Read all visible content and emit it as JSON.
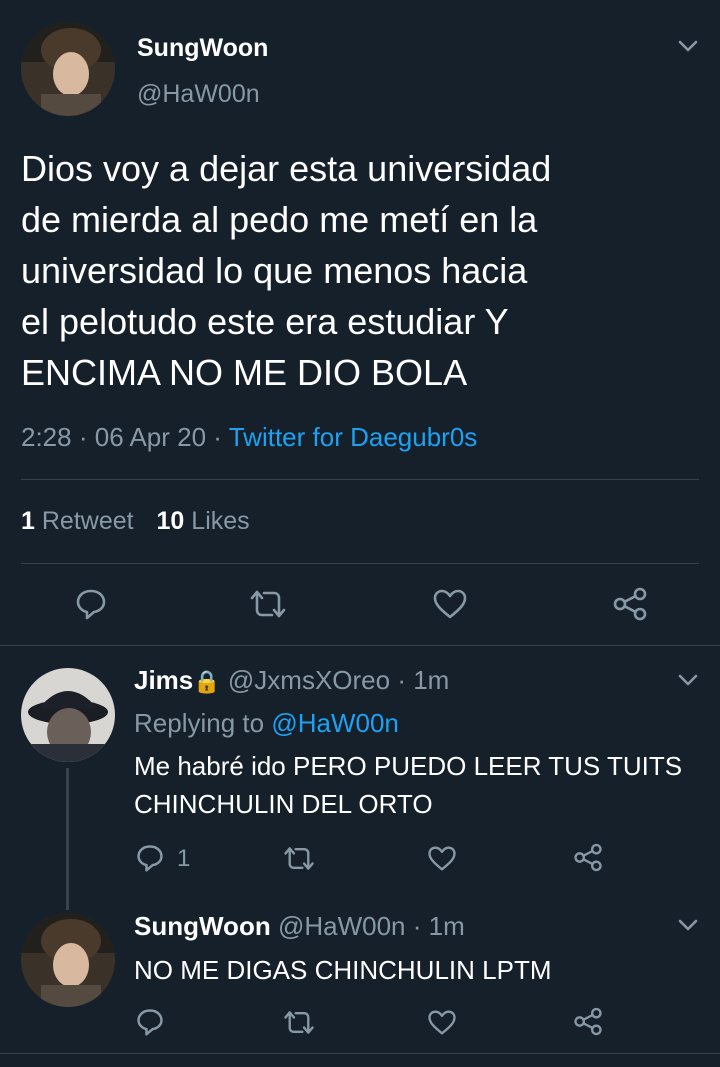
{
  "main_tweet": {
    "display_name": "SungWoon",
    "handle": "@HaW00n",
    "text_lines": [
      "Dios voy a dejar esta universidad",
      "de mierda al pedo me metí en la",
      "universidad lo que menos hacia",
      "el pelotudo este era estudiar Y",
      "ENCIMA NO ME DIO BOLA"
    ],
    "time": "2:28",
    "separator": "·",
    "date": "06 Apr 20",
    "source": "Twitter for Daegubr0s",
    "retweet_count": "1",
    "retweet_label": "Retweet",
    "like_count": "10",
    "like_label": "Likes"
  },
  "reply1": {
    "display_name": "Jims",
    "lock_glyph": "🔒",
    "handle": "@JxmsXOreo",
    "time": "· 1m",
    "replying_prefix": "Replying to",
    "replying_handle": "@HaW00n",
    "text_lines": [
      "Me habré ido PERO PUEDO LEER TUS TUITS",
      "CHINCHULIN DEL ORTO"
    ],
    "reply_count": "1"
  },
  "reply2": {
    "display_name": "SungWoon",
    "handle": "@HaW00n",
    "time": "· 1m",
    "text_lines": [
      "NO ME DIGAS CHINCHULIN LPTM"
    ]
  },
  "icons": [
    "chevron-down-icon",
    "reply-icon",
    "retweet-icon",
    "like-icon",
    "share-icon",
    "lock-icon"
  ],
  "colors": {
    "background": "#15202b",
    "muted": "#8899a6",
    "link": "#1da1f2",
    "divider": "#38444d"
  }
}
